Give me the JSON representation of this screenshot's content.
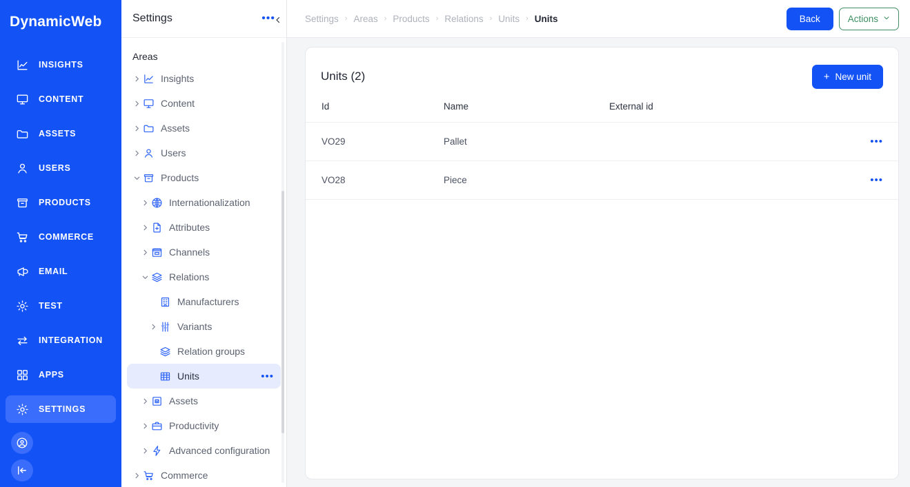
{
  "brand": {
    "name": "DynamicWeb"
  },
  "rail": {
    "items": [
      {
        "label": "INSIGHTS",
        "icon": "chart-line-icon",
        "active": false
      },
      {
        "label": "CONTENT",
        "icon": "monitor-icon",
        "active": false
      },
      {
        "label": "ASSETS",
        "icon": "folder-icon",
        "active": false
      },
      {
        "label": "USERS",
        "icon": "user-icon",
        "active": false
      },
      {
        "label": "PRODUCTS",
        "icon": "archive-box-icon",
        "active": false
      },
      {
        "label": "COMMERCE",
        "icon": "shopping-cart-icon",
        "active": false
      },
      {
        "label": "EMAIL",
        "icon": "megaphone-icon",
        "active": false
      },
      {
        "label": "TEST",
        "icon": "gear-icon",
        "active": false
      },
      {
        "label": "INTEGRATION",
        "icon": "exchange-arrows-icon",
        "active": false
      },
      {
        "label": "APPS",
        "icon": "grid-squares-icon",
        "active": false
      },
      {
        "label": "SETTINGS",
        "icon": "gear-icon",
        "active": true
      }
    ],
    "bottom": [
      {
        "icon": "account-circle-icon"
      },
      {
        "icon": "collapse-left-icon"
      }
    ]
  },
  "panel": {
    "title": "Settings",
    "menu_icon": "ellipsis-icon",
    "collapse_icon": "chevron-left-icon",
    "areas_label": "Areas",
    "tree": [
      {
        "label": "Insights",
        "icon": "chart-line-icon",
        "indent": 0,
        "caret": "collapsed"
      },
      {
        "label": "Content",
        "icon": "monitor-icon",
        "indent": 0,
        "caret": "collapsed"
      },
      {
        "label": "Assets",
        "icon": "folder-icon",
        "indent": 0,
        "caret": "collapsed"
      },
      {
        "label": "Users",
        "icon": "user-icon",
        "indent": 0,
        "caret": "collapsed"
      },
      {
        "label": "Products",
        "icon": "archive-box-icon",
        "indent": 0,
        "caret": "expanded"
      },
      {
        "label": "Internationalization",
        "icon": "globe-icon",
        "indent": 1,
        "caret": "collapsed"
      },
      {
        "label": "Attributes",
        "icon": "file-plus-icon",
        "indent": 1,
        "caret": "collapsed"
      },
      {
        "label": "Channels",
        "icon": "storefront-icon",
        "indent": 1,
        "caret": "collapsed"
      },
      {
        "label": "Relations",
        "icon": "layers-icon",
        "indent": 1,
        "caret": "expanded"
      },
      {
        "label": "Manufacturers",
        "icon": "building-icon",
        "indent": 2,
        "caret": "none"
      },
      {
        "label": "Variants",
        "icon": "sliders-icon",
        "indent": 2,
        "caret": "collapsed"
      },
      {
        "label": "Relation groups",
        "icon": "layers-icon",
        "indent": 2,
        "caret": "none"
      },
      {
        "label": "Units",
        "icon": "table-grid-icon",
        "indent": 2,
        "caret": "none",
        "selected": true,
        "menu_icon": "ellipsis-icon"
      },
      {
        "label": "Assets",
        "icon": "image-frame-icon",
        "indent": 1,
        "caret": "collapsed"
      },
      {
        "label": "Productivity",
        "icon": "briefcase-icon",
        "indent": 1,
        "caret": "collapsed"
      },
      {
        "label": "Advanced configuration",
        "icon": "lightning-icon",
        "indent": 1,
        "caret": "collapsed"
      },
      {
        "label": "Commerce",
        "icon": "shopping-cart-icon",
        "indent": 0,
        "caret": "collapsed"
      }
    ]
  },
  "topbar": {
    "breadcrumbs": [
      "Settings",
      "Areas",
      "Products",
      "Relations",
      "Units",
      "Units"
    ],
    "separator": "›",
    "back_label": "Back",
    "actions_label": "Actions",
    "actions_chevron": "chevron-down-icon",
    "accent": "#1352f5",
    "actions_color": "#3f8f63"
  },
  "card": {
    "title": "Units (2)",
    "new_button": {
      "label": "New unit",
      "icon": "plus-icon"
    },
    "columns": [
      "Id",
      "Name",
      "External id"
    ],
    "rows": [
      {
        "id": "VO29",
        "name": "Pallet",
        "external_id": "",
        "menu_icon": "ellipsis-icon"
      },
      {
        "id": "VO28",
        "name": "Piece",
        "external_id": "",
        "menu_icon": "ellipsis-icon"
      }
    ]
  }
}
